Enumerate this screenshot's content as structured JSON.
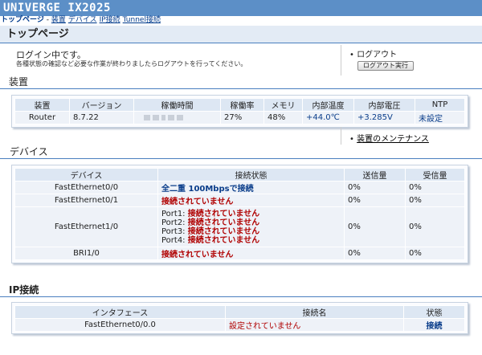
{
  "header": {
    "title": "UNIVERGE IX2025"
  },
  "nav": {
    "current": "トップページ",
    "sep": "-",
    "items": [
      "装置",
      "デバイス",
      "IP接続",
      "Tunnel接続"
    ]
  },
  "page": {
    "title": "トップページ"
  },
  "login": {
    "status": "ログイン中です。",
    "message": "各種状態の確認など必要な作業が終わりましたらログアウトを行ってください。",
    "logout_label": "ログアウト",
    "logout_button": "ログアウト実行"
  },
  "device_section": {
    "title": "装置",
    "headers": [
      "装置",
      "バージョン",
      "稼働時間",
      "稼働率",
      "メモリ",
      "内部温度",
      "内部電圧",
      "NTP"
    ],
    "row": {
      "device": "Router",
      "version": "8.7.22",
      "uptime_rate": "27%",
      "memory": "48%",
      "temperature": "+44.0℃",
      "voltage": "+3.285V",
      "ntp": "未設定"
    },
    "maintenance_link": "装置のメンテナンス"
  },
  "devices_section": {
    "title": "デバイス",
    "headers": [
      "デバイス",
      "接続状態",
      "送信量",
      "受信量"
    ],
    "rows": [
      {
        "name": "FastEthernet0/0",
        "status": "全二重 100Mbpsで接続",
        "tx": "0%",
        "rx": "0%"
      },
      {
        "name": "FastEthernet0/1",
        "status": "接続されていません",
        "tx": "0%",
        "rx": "0%"
      },
      {
        "name": "FastEthernet1/0",
        "ports": [
          {
            "label": "Port1:",
            "status": "接続されていません"
          },
          {
            "label": "Port2:",
            "status": "接続されていません"
          },
          {
            "label": "Port3:",
            "status": "接続されていません"
          },
          {
            "label": "Port4:",
            "status": "接続されていません"
          }
        ],
        "tx": "0%",
        "rx": "0%"
      },
      {
        "name": "BRI1/0",
        "status": "接続されていません",
        "tx": "0%",
        "rx": "0%"
      }
    ]
  },
  "ip_section": {
    "title": "IP接続",
    "headers": [
      "インタフェース",
      "接続名",
      "状態"
    ],
    "rows": [
      {
        "interface": "FastEthernet0/0.0",
        "name": "設定されていません",
        "state": "接続"
      }
    ]
  },
  "colors": {
    "banner": "#5c8fc7",
    "link": "#003a8c",
    "connected": "#0a3d8a",
    "disconnected": "#b00000"
  }
}
